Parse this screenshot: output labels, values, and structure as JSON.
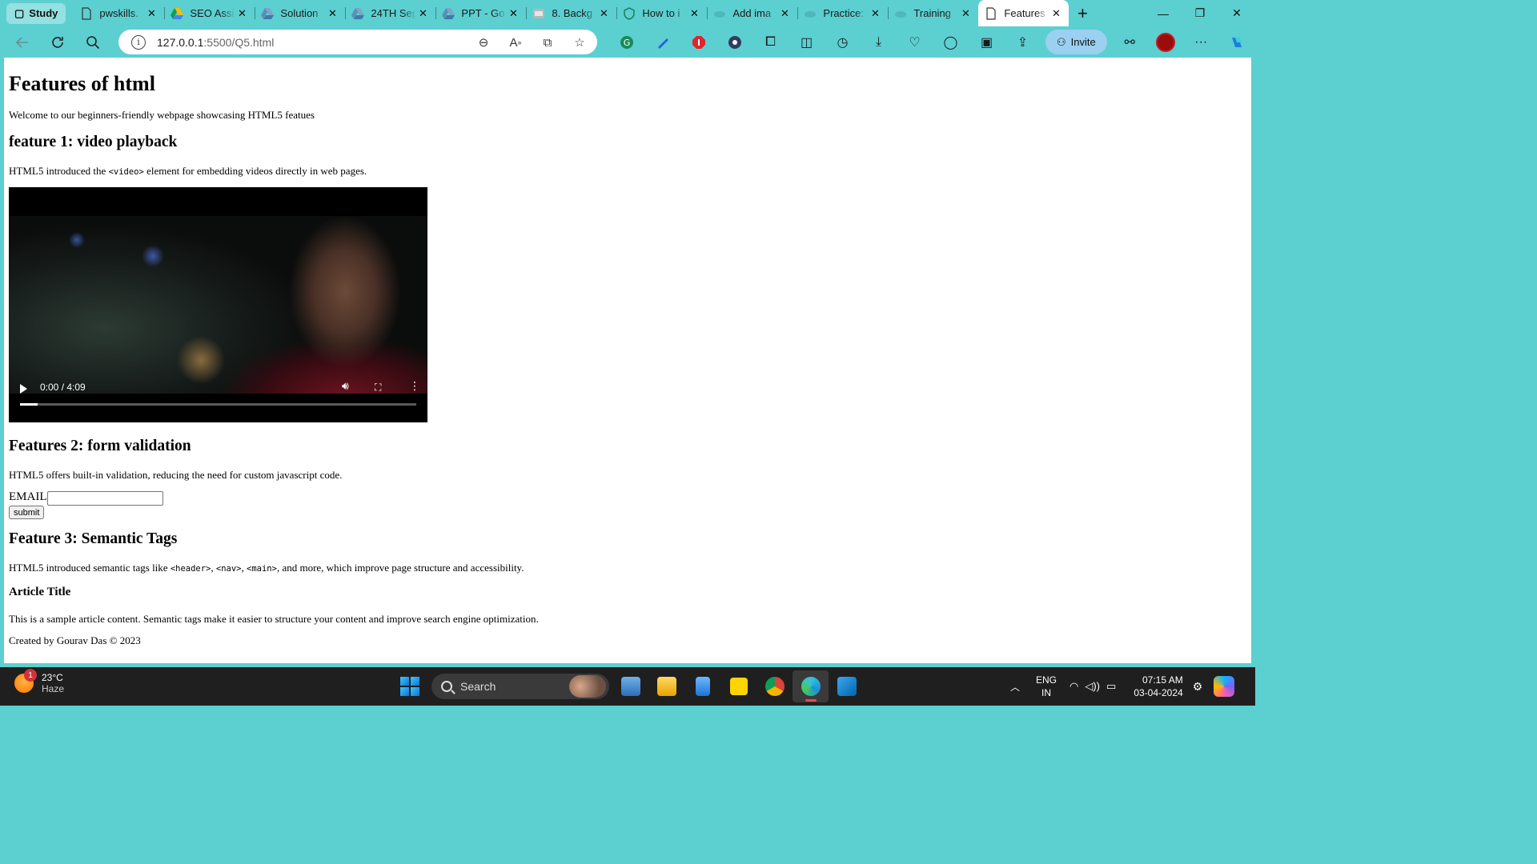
{
  "browser": {
    "workspace": "Study",
    "tabs": [
      {
        "label": "pwskills.",
        "icon": "document-icon"
      },
      {
        "label": "SEO Assi",
        "icon": "drive-icon"
      },
      {
        "label": "Solution",
        "icon": "drive-icon"
      },
      {
        "label": "24TH Sep",
        "icon": "drive-icon"
      },
      {
        "label": "PPT - Go",
        "icon": "drive-icon"
      },
      {
        "label": "8. Backg",
        "icon": "slides-icon"
      },
      {
        "label": "How to i",
        "icon": "shield-icon"
      },
      {
        "label": "Add ima",
        "icon": "cloud-icon"
      },
      {
        "label": "Practice:",
        "icon": "cloud-icon"
      },
      {
        "label": "Training",
        "icon": "cloud-icon"
      },
      {
        "label": "Features",
        "icon": "document-icon",
        "active": true
      }
    ],
    "address": {
      "host": "127.0.0.1",
      "rest": ":5500/Q5.html"
    },
    "invite_label": "Invite"
  },
  "page": {
    "title": "Features of html",
    "intro": "Welcome to our beginners-friendly webpage showcasing HTML5 featues",
    "feature1": {
      "heading": "feature 1: video playback",
      "text_before": "HTML5 introduced the ",
      "code": "<video>",
      "text_after": " element for embedding videos directly in web pages."
    },
    "video": {
      "time": "0:00 / 4:09",
      "progress_fraction": 0.045
    },
    "feature2": {
      "heading": "Features 2: form validation",
      "text": "HTML5 offers built-in validation, reducing the need for custom javascript code.",
      "email_label": "EMAIL:",
      "email_value": "",
      "submit_label": "submit"
    },
    "feature3": {
      "heading": "Feature 3: Semantic Tags",
      "text_before": "HTML5 introduced semantic tags like ",
      "code1": "<header>",
      "sep1": ", ",
      "code2": "<nav>",
      "sep2": ", ",
      "code3": "<main>",
      "text_after": ", and more, which improve page structure and accessibility."
    },
    "article": {
      "title": "Article Title",
      "content": "This is a sample article content. Semantic tags make it easier to structure your content and improve search engine optimization."
    },
    "footer": "Created by Gourav Das © 2023"
  },
  "taskbar": {
    "weather": {
      "temp": "23°C",
      "condition": "Haze",
      "badge": "1"
    },
    "search_label": "Search",
    "lang_top": "ENG",
    "lang_bottom": "IN",
    "time": "07:15 AM",
    "date": "03-04-2024"
  },
  "colors": {
    "browser_frame": "#5ccfd1",
    "taskbar": "#1f1f1f",
    "active_indicator": "#e74856"
  }
}
